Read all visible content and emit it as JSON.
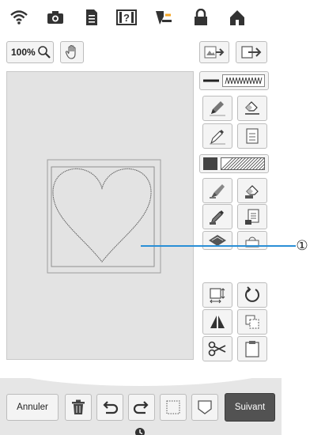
{
  "zoom": {
    "label": "100%"
  },
  "bottom_bar": {
    "cancel_label": "Annuler",
    "next_label": "Suivant"
  },
  "callout": {
    "number": "①"
  },
  "colors": {
    "next_button": "#525252",
    "callout_line": "#2a8fd6",
    "canvas": "#e3e3e3"
  }
}
